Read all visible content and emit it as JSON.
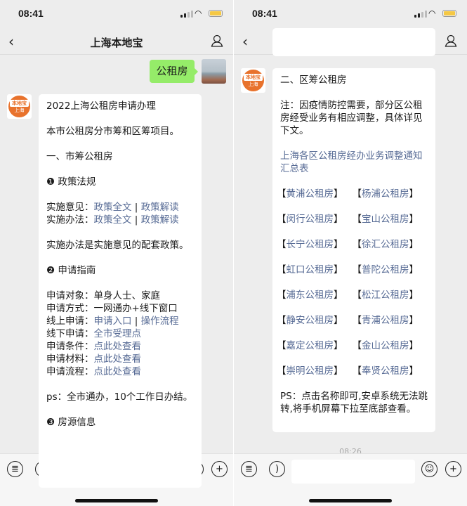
{
  "status": {
    "time": "08:41"
  },
  "nav": {
    "title": "上海本地宝"
  },
  "left": {
    "my_message": "公租房",
    "avatar": {
      "logo": "本地宝",
      "sub": "上海"
    },
    "paragraphs": [
      [
        [
          {
            "t": "2022上海公租房申请办理"
          }
        ]
      ],
      [
        [
          {
            "t": "本市公租房分市筹和区筹项目。"
          }
        ]
      ],
      [
        [
          {
            "t": "一、市筹公租房"
          }
        ]
      ],
      [
        [
          {
            "t": "❶ 政策法规"
          }
        ]
      ],
      [
        [
          {
            "t": "实施意见："
          },
          {
            "t": "政策全文",
            "l": 1
          },
          {
            "t": " | "
          },
          {
            "t": "政策解读",
            "l": 1
          }
        ],
        [
          {
            "t": "实施办法："
          },
          {
            "t": "政策全文",
            "l": 1
          },
          {
            "t": " | "
          },
          {
            "t": "政策解读",
            "l": 1
          }
        ]
      ],
      [
        [
          {
            "t": "实施办法是实施意见的配套政策。"
          }
        ]
      ],
      [
        [
          {
            "t": "❷ 申请指南"
          }
        ]
      ],
      [
        [
          {
            "t": "申请对象：单身人士、家庭"
          }
        ],
        [
          {
            "t": "申请方式：一网通办+线下窗口"
          }
        ],
        [
          {
            "t": "线上申请："
          },
          {
            "t": "申请入口",
            "l": 1
          },
          {
            "t": " | "
          },
          {
            "t": "操作流程",
            "l": 1
          }
        ],
        [
          {
            "t": "线下申请："
          },
          {
            "t": "全市受理点",
            "l": 1
          }
        ],
        [
          {
            "t": "申请条件："
          },
          {
            "t": "点此处查看",
            "l": 1
          }
        ],
        [
          {
            "t": "申请材料："
          },
          {
            "t": "点此处查看",
            "l": 1
          }
        ],
        [
          {
            "t": "申请流程："
          },
          {
            "t": "点此处查看",
            "l": 1
          }
        ]
      ],
      [
        [
          {
            "t": "ps：全市通办，10个工作日办结。"
          }
        ]
      ],
      [
        [
          {
            "t": "❸ 房源信息"
          }
        ]
      ]
    ]
  },
  "right": {
    "avatar": {
      "logo": "本地宝",
      "sub": "上海"
    },
    "heading": "二、区筹公租房",
    "note": "注：因疫情防控需要，部分区公租房经受业务有相应调整，具体详见下文。",
    "summary_link": "上海各区公租房经办业务调整通知汇总表",
    "districts": [
      "黄浦公租房",
      "杨浦公租房",
      "闵行公租房",
      "宝山公租房",
      "长宁公租房",
      "徐汇公租房",
      "虹口公租房",
      "普陀公租房",
      "浦东公租房",
      "松江公租房",
      "静安公租房",
      "青浦公租房",
      "嘉定公租房",
      "金山公租房",
      "崇明公租房",
      "奉贤公租房"
    ],
    "ps": "PS：点击名称即可,安卓系统无法跳转,将手机屏幕下拉至底部查看。",
    "timestamp": "08:26"
  },
  "colors": {
    "link": "#576b95",
    "my_bubble": "#95ec69",
    "background": "#ededed"
  }
}
